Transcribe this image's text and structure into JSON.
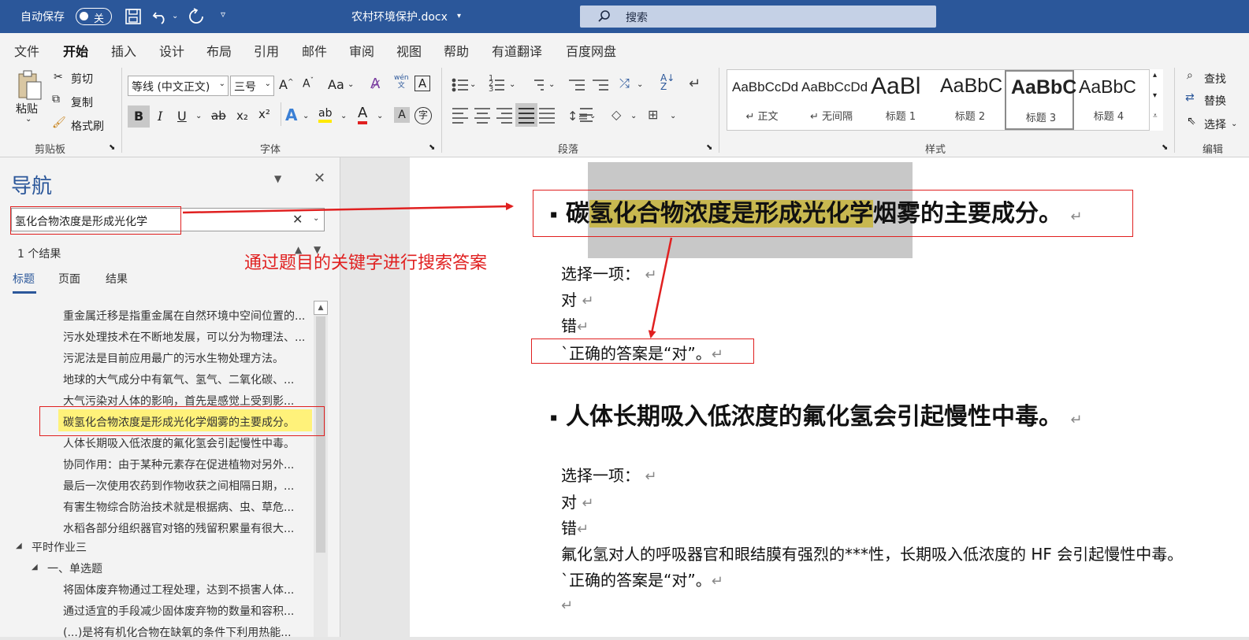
{
  "titlebar": {
    "autosave_label": "自动保存",
    "autosave_state": "关",
    "filename": "农村环境保护.docx",
    "search_placeholder": "搜索"
  },
  "tabs": [
    "文件",
    "开始",
    "插入",
    "设计",
    "布局",
    "引用",
    "邮件",
    "审阅",
    "视图",
    "帮助",
    "有道翻译",
    "百度网盘"
  ],
  "ribbon": {
    "clipboard": {
      "paste": "粘贴",
      "cut": "剪切",
      "copy": "复制",
      "format_painter": "格式刷",
      "group": "剪贴板"
    },
    "font": {
      "font_name": "等线 (中文正文)",
      "font_size": "三号",
      "aa": "Aa",
      "group": "字体",
      "bold": "B",
      "italic": "I",
      "underline": "U",
      "strike": "ab",
      "sub": "x₂",
      "sup": "x²",
      "texteffect": "A",
      "highlight": "ab",
      "fontcolor": "A",
      "wen": "wén\n文",
      "charshade": "A",
      "encircle": "字"
    },
    "paragraph": {
      "group": "段落"
    },
    "styles": {
      "group": "样式",
      "items": [
        {
          "preview": "AaBbCcDd",
          "name": "↵ 正文"
        },
        {
          "preview": "AaBbCcDd",
          "name": "↵ 无间隔"
        },
        {
          "preview": "AaBl",
          "name": "标题 1"
        },
        {
          "preview": "AaBbC",
          "name": "标题 2"
        },
        {
          "preview": "AaBbC",
          "name": "标题 3"
        },
        {
          "preview": "AaBbC",
          "name": "标题 4"
        }
      ]
    },
    "editing": {
      "find": "查找",
      "replace": "替换",
      "select": "选择",
      "group": "编辑"
    }
  },
  "nav": {
    "title": "导航",
    "search_value": "氢化合物浓度是形成光化学",
    "result_count": "1 个结果",
    "tabs": [
      "标题",
      "页面",
      "结果"
    ],
    "items": [
      "重金属迁移是指重金属在自然环境中空间位置的...",
      "污水处理技术在不断地发展，可以分为物理法、...",
      "污泥法是目前应用最广的污水生物处理方法。",
      "地球的大气成分中有氧气、氢气、二氧化碳、...",
      "大气污染对人体的影响，首先是感觉上受到影...",
      "碳氢化合物浓度是形成光化学烟雾的主要成分。",
      "人体长期吸入低浓度的氟化氢会引起慢性中毒。",
      "协同作用：由于某种元素存在促进植物对另外...",
      "最后一次使用农药到作物收获之间相隔日期，...",
      "有害生物综合防治技术就是根据病、虫、草危...",
      "水稻各部分组织器官对铬的残留积累量有很大..."
    ],
    "section": "平时作业三",
    "subsection": "一、单选题",
    "sub_items": [
      "将固体废弃物通过工程处理，达到不损害人体...",
      "通过适宜的手段减少固体废弃物的数量和容积...",
      "(...)是将有机化合物在缺氧的条件下利用热能..."
    ]
  },
  "doc": {
    "q1_prefix": "碳",
    "q1_highlight": "氢化合物浓度是形成光化学",
    "q1_suffix": "烟雾的主要成分。",
    "choose": "选择一项：",
    "opt_true": "对",
    "opt_false": "错",
    "answer1": "`正确的答案是“对”。",
    "q2": "人体长期吸入低浓度的氟化氢会引起慢性中毒。",
    "explain2": "氟化氢对人的呼吸器官和眼结膜有强烈的***性，长期吸入低浓度的 HF 会引起慢性中毒。",
    "answer2": "`正确的答案是“对”。",
    "ret": "↵",
    "bullet": "▪"
  },
  "annotation": "通过题目的关键字进行搜索答案",
  "colors": {
    "title_blue": "#2b579a",
    "red": "#e02020",
    "highlight": "#c8b850",
    "nav_selected": "#fff27a"
  }
}
